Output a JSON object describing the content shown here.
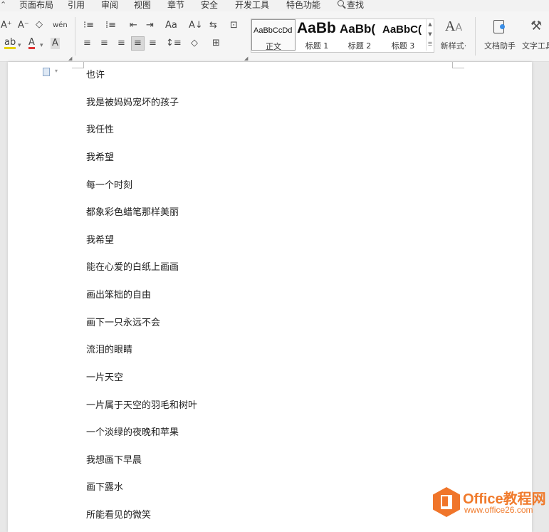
{
  "menu": {
    "items": [
      "页面布局",
      "引用",
      "审阅",
      "视图",
      "章节",
      "安全",
      "开发工具",
      "特色功能"
    ],
    "search_label": "查找"
  },
  "ribbon": {
    "styles": [
      {
        "sample": "AaBbCcDd",
        "name": "正文"
      },
      {
        "sample": "AaBb",
        "name": "标题 1"
      },
      {
        "sample": "AaBb(",
        "name": "标题 2"
      },
      {
        "sample": "AaBbC(",
        "name": "标题 3"
      }
    ],
    "new_style_label": "新样式·",
    "doc_helper_label": "文档助手",
    "text_tools_label": "文字工具",
    "glyphs": {
      "font_grow": "A⁺",
      "font_shrink": "A⁻",
      "clear": "◇",
      "phonetic": "wén",
      "highlight": "ab",
      "font_color": "A",
      "char_shade": "A",
      "bullets": "⁝≡",
      "numbering": "⁞≡",
      "outdent": "⇤",
      "indent": "⇥",
      "case": "Aa",
      "sort": "A↓",
      "spacing": "⇆",
      "borders": "⊡",
      "align_left": "≡",
      "align_center": "≡",
      "align_right": "≡",
      "justify": "≡",
      "distribute": "≡",
      "line_spacing": "↕≡",
      "shading": "◇",
      "table_border": "⊞"
    }
  },
  "document": {
    "lines": [
      "也许",
      "我是被妈妈宠坏的孩子",
      "我任性",
      "我希望",
      "每一个时刻",
      "都象彩色蜡笔那样美丽",
      "我希望",
      "能在心爱的白纸上画画",
      "画出笨拙的自由",
      "画下一只永远不会",
      "流泪的眼睛",
      "一片天空",
      "一片属于天空的羽毛和树叶",
      "一个淡绿的夜晚和苹果",
      "我想画下早晨",
      "画下露水",
      "所能看见的微笑"
    ]
  },
  "watermark": {
    "title": "Office教程网",
    "url": "www.office26.com"
  }
}
